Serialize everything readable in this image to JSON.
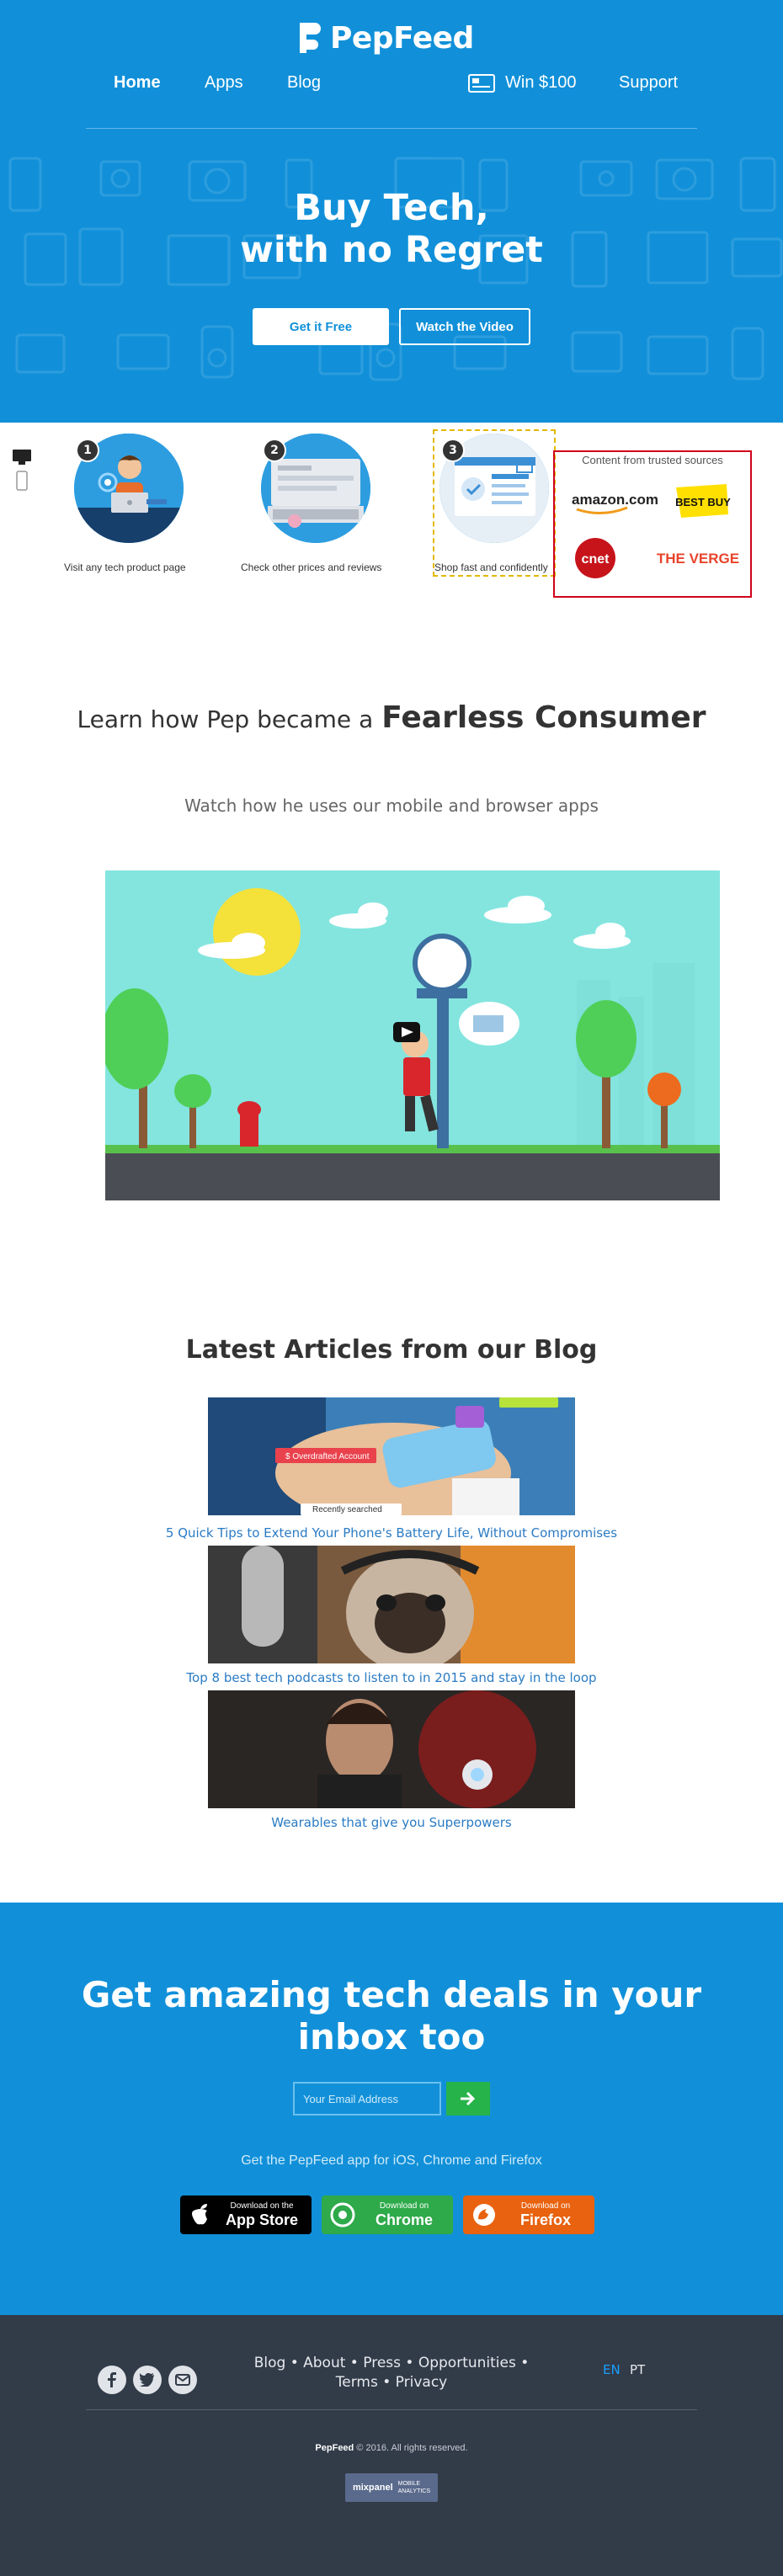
{
  "brand": {
    "name": "PepFeed"
  },
  "nav": {
    "home": "Home",
    "apps": "Apps",
    "blog": "Blog",
    "win": "Win $100",
    "support": "Support"
  },
  "hero": {
    "title_line1": "Buy Tech,",
    "title_line2": "with no Regret",
    "get_free": "Get it Free",
    "watch_video": "Watch the Video"
  },
  "steps": [
    {
      "num": "1",
      "label": "Visit any tech product page"
    },
    {
      "num": "2",
      "label": "Check other prices and reviews"
    },
    {
      "num": "3",
      "label": "Shop fast and confidently"
    }
  ],
  "trusted": {
    "title": "Content from trusted sources",
    "logos": [
      "amazon.com",
      "BEST BUY",
      "cnet",
      "THE VERGE"
    ]
  },
  "learn": {
    "title_light": "Learn how Pep became a",
    "title_bold": "Fearless Consumer",
    "subtitle": "Watch how he uses our mobile and browser apps"
  },
  "blog": {
    "title": "Latest Articles from our Blog",
    "articles": [
      {
        "title": "5 Quick Tips to Extend Your Phone's Battery Life, Without Compromises",
        "overlay1": "$ Overdrafted Account",
        "overlay2": "Recently searched"
      },
      {
        "title": "Top 8 best tech podcasts to listen to in 2015 and stay in the loop"
      },
      {
        "title": "Wearables that give you Superpowers"
      }
    ]
  },
  "cta": {
    "title": "Get amazing tech deals in your inbox too",
    "email_placeholder": "Your Email Address",
    "apps_text": "Get the PepFeed app for iOS, Chrome and Firefox",
    "appstore_small": "Download on the",
    "appstore_big": "App Store",
    "chrome_small": "Download on",
    "chrome_big": "Chrome",
    "firefox_small": "Download on",
    "firefox_big": "Firefox",
    "colors": {
      "appstore": "#000000",
      "chrome": "#2eaa4a",
      "firefox": "#e8620f"
    }
  },
  "footer": {
    "links": [
      "Blog",
      "About",
      "Press",
      "Opportunities",
      "Terms",
      "Privacy"
    ],
    "lang_en": "EN",
    "lang_pt": "PT",
    "copyright_brand": "PepFeed",
    "copyright_rest": "© 2016. All rights reserved.",
    "mixpanel_brand": "mixpanel",
    "mixpanel_line1": "MOBILE",
    "mixpanel_line2": "ANALYTICS",
    "social": [
      "facebook-icon",
      "twitter-icon",
      "email-icon"
    ]
  }
}
